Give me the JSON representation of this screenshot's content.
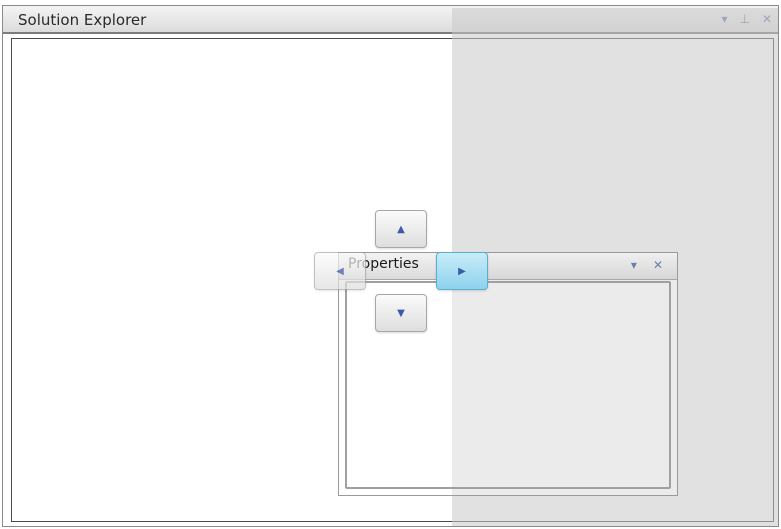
{
  "solution_explorer": {
    "title": "Solution Explorer",
    "icons": [
      "dropdown-arrow-icon",
      "pin-icon",
      "close-icon"
    ]
  },
  "properties_window": {
    "title": "Properties",
    "icons": [
      "dropdown-arrow-icon",
      "close-icon"
    ]
  },
  "dock_guides": [
    "dock-top",
    "dock-left",
    "dock-right",
    "dock-bottom"
  ],
  "glyphs": {
    "dropdown": "▾",
    "pin": "⊥",
    "close": "✕",
    "up": "▲",
    "down": "▼",
    "left": "◀",
    "right": "▶"
  },
  "colors": {
    "active_guide": "#8ed2ee",
    "preview_overlay": "#dcdcdc"
  }
}
